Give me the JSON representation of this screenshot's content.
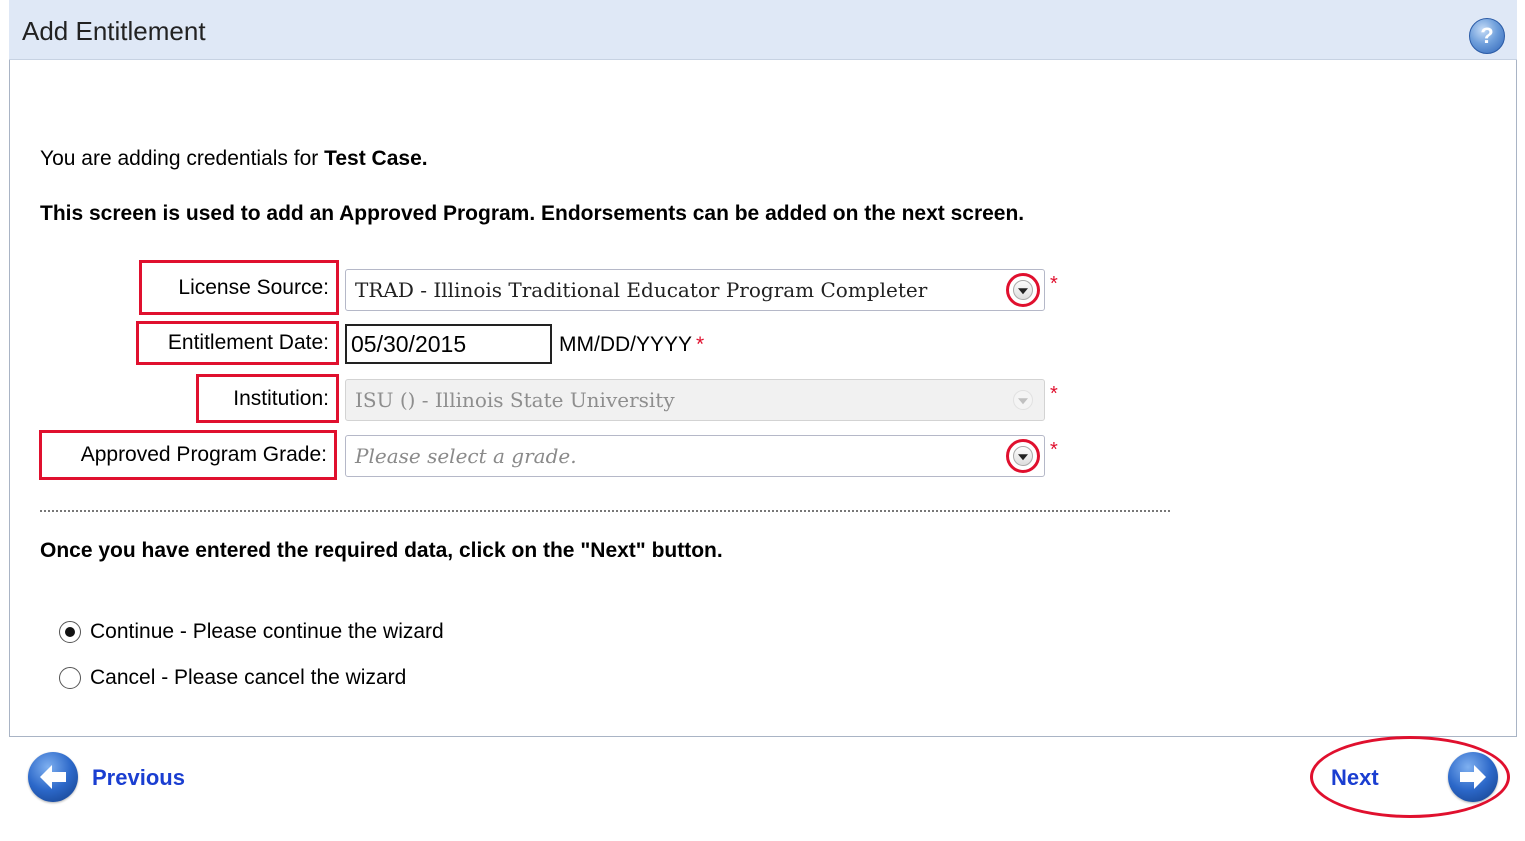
{
  "window": {
    "title": "Add Entitlement",
    "help_icon": "help-icon"
  },
  "intro": {
    "prefix": "You are adding credentials for ",
    "name": "Test Case."
  },
  "purpose": "This screen is used to add an Approved Program. Endorsements can be added on the next screen.",
  "form": {
    "license_source_label": "License Source:",
    "license_source_value": "TRAD - Illinois Traditional Educator Program Completer",
    "entitlement_date_label": "Entitlement Date:",
    "entitlement_date_value": "05/30/2015",
    "entitlement_date_hint": "MM/DD/YYYY",
    "institution_label": "Institution:",
    "institution_value": "ISU () - Illinois State University",
    "grade_label": "Approved Program Grade:",
    "grade_placeholder": "Please select a grade.",
    "required_marker": "*"
  },
  "instruction": "Once you have entered the required data, click on the \"Next\" button.",
  "options": [
    {
      "label": "Continue - Please continue the wizard",
      "selected": true
    },
    {
      "label": "Cancel - Please cancel the wizard",
      "selected": false
    }
  ],
  "nav": {
    "previous_label": "Previous",
    "next_label": "Next"
  },
  "colors": {
    "header_bg": "#dfe8f6",
    "highlight_red": "#e0102e",
    "link_blue": "#1a3ed1"
  }
}
